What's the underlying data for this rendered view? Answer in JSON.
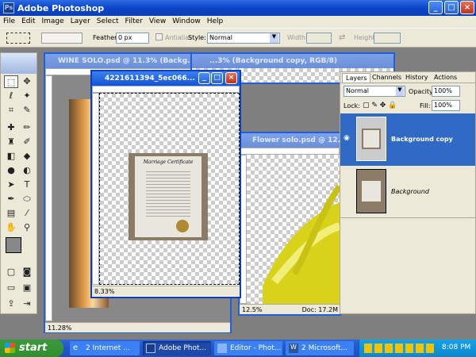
{
  "app": {
    "title": "Adobe Photoshop"
  },
  "menu": [
    "File",
    "Edit",
    "Image",
    "Layer",
    "Select",
    "Filter",
    "View",
    "Window",
    "Help"
  ],
  "options": {
    "feather_label": "Feather:",
    "feather_value": "0 px",
    "antialias_label": "Antialias",
    "style_label": "Style:",
    "style_value": "Normal",
    "width_label": "Width:",
    "height_label": "Height:"
  },
  "docs": {
    "wine": {
      "title": "WINE SOLO.psd @ 11.3% (Backg...",
      "zoom": "11.28%"
    },
    "copy": {
      "title": "...3% (Background copy, RGB/8)"
    },
    "cert": {
      "title": "4221611394_5ec066...",
      "zoom": "8.33%",
      "cert_heading": "Marriage Certificate"
    },
    "flower": {
      "title": "Flower solo.psd @ 12.5...",
      "zoom": "12.5%",
      "doc": "Doc: 17.2M"
    }
  },
  "layers_panel": {
    "tabs": [
      "Layers",
      "Channels",
      "History",
      "Actions"
    ],
    "blend": "Normal",
    "opacity_label": "Opacity:",
    "opacity": "100%",
    "lock_label": "Lock:",
    "fill_label": "Fill:",
    "fill": "100%",
    "layers": [
      {
        "name": "Background copy",
        "selected": true
      },
      {
        "name": "Background",
        "selected": false
      }
    ]
  },
  "taskbar": {
    "start": "start",
    "buttons": [
      "2 Internet ...",
      "Adobe Phot...",
      "Editor - Phot...",
      "2 Microsoft..."
    ],
    "clock": "8:08 PM"
  },
  "colors": {
    "xp_blue": "#0a46c8",
    "selected_layer": "#316ac5",
    "taskbar": "#2457c8"
  }
}
